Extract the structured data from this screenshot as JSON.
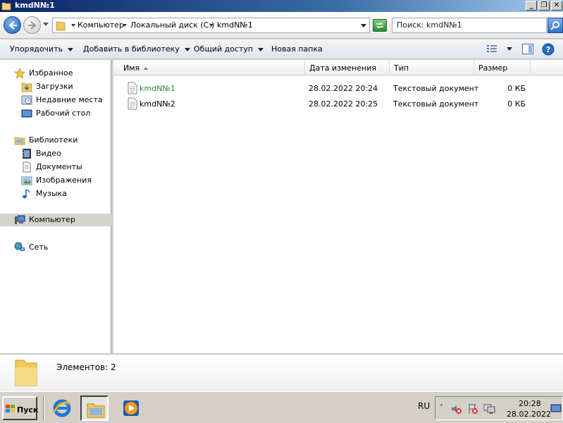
{
  "window": {
    "title": "kmdN№1",
    "min_glyph": "_",
    "restore_glyph": "❐",
    "close_glyph": "✕"
  },
  "address": {
    "crumbs": [
      "Компьютер",
      "Локальный диск (C:)",
      "kmdN№1"
    ],
    "search_text": "Поиск: kmdN№1"
  },
  "toolbar": {
    "organize": "Упорядочить",
    "add_to_library": "Добавить в библиотеку",
    "share": "Общий доступ",
    "new_folder": "Новая папка"
  },
  "nav": {
    "favorites": "Избранное",
    "downloads": "Загрузки",
    "recent": "Недавние места",
    "desktop": "Рабочий стол",
    "libraries": "Библиотеки",
    "video": "Видео",
    "documents": "Документы",
    "images": "Изображения",
    "music": "Музыка",
    "computer": "Компьютер",
    "network": "Сеть"
  },
  "columns": {
    "name": "Имя",
    "date": "Дата изменения",
    "type": "Тип",
    "size": "Размер"
  },
  "files": [
    {
      "name": "kmdN№1",
      "date": "28.02.2022 20:24",
      "type": "Текстовый документ",
      "size": "0 КБ"
    },
    {
      "name": "kmdN№2",
      "date": "28.02.2022 20:25",
      "type": "Текстовый документ",
      "size": "0 КБ"
    }
  ],
  "details": {
    "count_text": "Элементов: 2"
  },
  "taskbar": {
    "start": "Пуск",
    "lang": "RU",
    "time": "20:28",
    "date": "28.02.2022",
    "tray_chevron": "˄"
  },
  "colors": {
    "accent": "#1c5fb3",
    "highlight_file": "#2f8a2f",
    "selected_nav": "#d6d3cd"
  }
}
